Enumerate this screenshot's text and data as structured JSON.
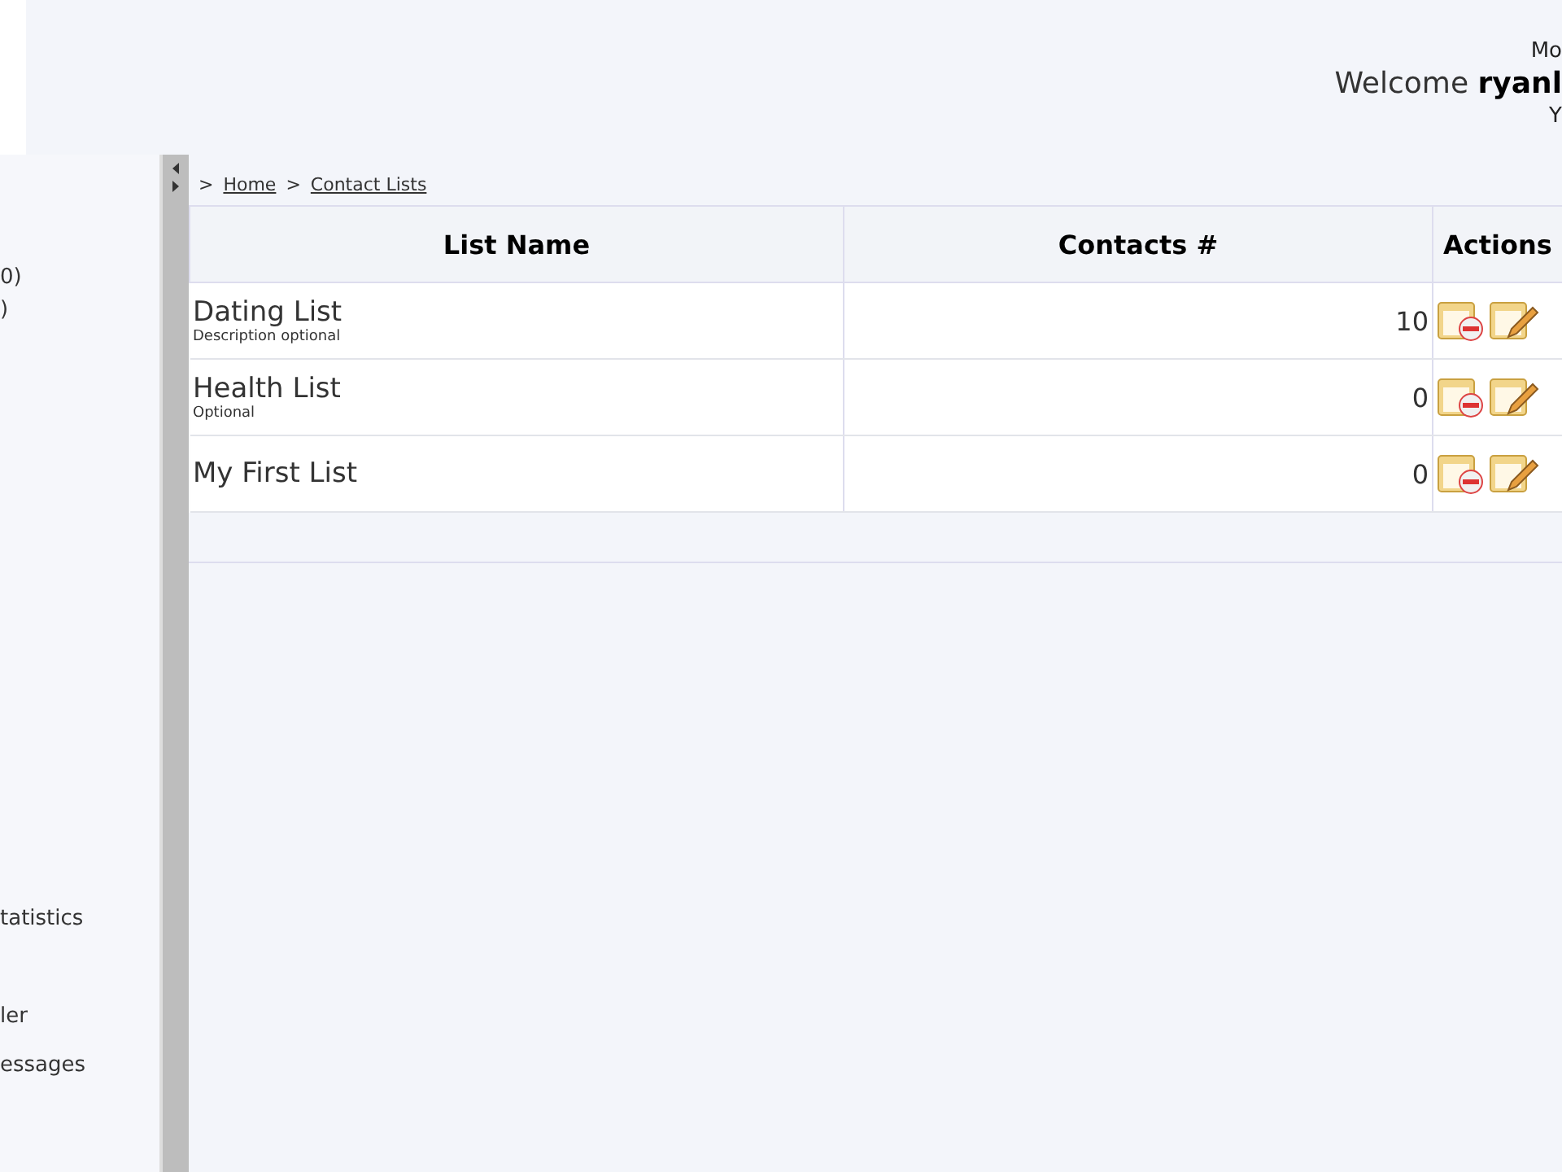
{
  "header": {
    "top_text": "Mo",
    "welcome": "Welcome **ryanl**",
    "bottom_text": "Y"
  },
  "sidebar": {
    "items": [
      {
        "label": "0)"
      },
      {
        "label": ")"
      },
      {
        "label": "tatistics"
      },
      {
        "label": "ler"
      },
      {
        "label": "essages"
      }
    ]
  },
  "breadcrumb": [
    {
      "separator": ">",
      "label": "Home"
    },
    {
      "separator": ">",
      "label": "Contact Lists"
    }
  ],
  "table": {
    "columns": [
      "List Name",
      "Contacts #",
      "Actions"
    ],
    "rows": [
      {
        "name": "Dating List",
        "description": "Description optional",
        "contacts": "10"
      },
      {
        "name": "Health List",
        "description": "Optional",
        "contacts": "0"
      },
      {
        "name": "My First List",
        "contacts": "0"
      }
    ]
  }
}
